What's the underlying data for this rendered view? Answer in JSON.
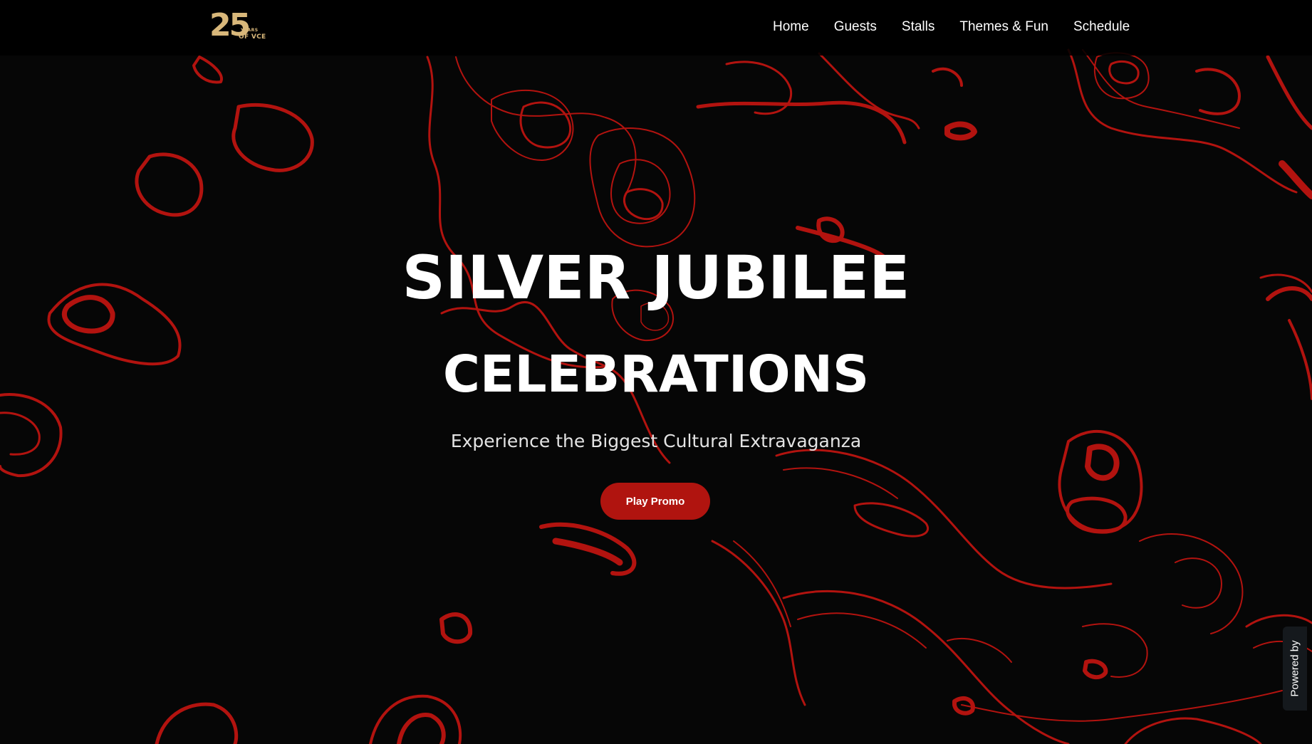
{
  "logo": {
    "number": "25",
    "line1": "YEARS",
    "line2": "OF VCE",
    "color": "#d8b77a"
  },
  "nav": {
    "items": [
      {
        "label": "Home"
      },
      {
        "label": "Guests"
      },
      {
        "label": "Stalls"
      },
      {
        "label": "Themes & Fun"
      },
      {
        "label": "Schedule"
      }
    ]
  },
  "hero": {
    "title_line1": "SILVER JUBILEE",
    "title_line2": "CELEBRATIONS",
    "subtitle": "Experience the Biggest Cultural Extravaganza",
    "cta_label": "Play Promo"
  },
  "badge": {
    "label": "Powered by"
  },
  "colors": {
    "background": "#060606",
    "accent": "#b0140f",
    "contour": "#b2130f"
  }
}
